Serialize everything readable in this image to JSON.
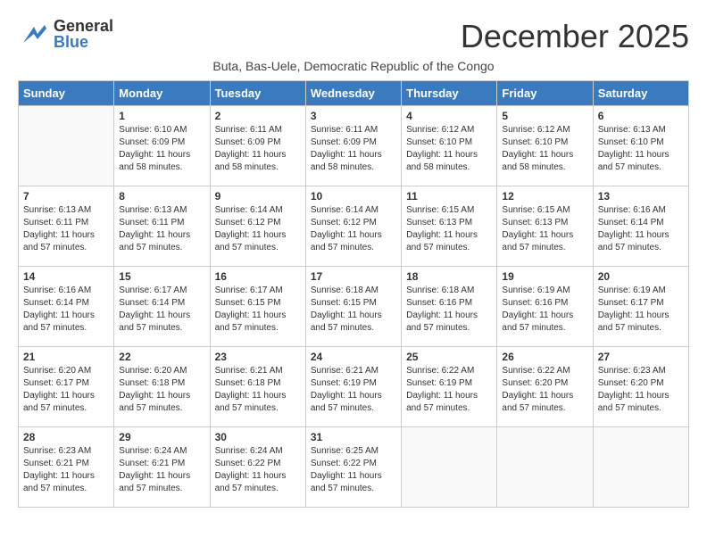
{
  "header": {
    "logo_general": "General",
    "logo_blue": "Blue",
    "month_title": "December 2025",
    "subtitle": "Buta, Bas-Uele, Democratic Republic of the Congo"
  },
  "days_of_week": [
    "Sunday",
    "Monday",
    "Tuesday",
    "Wednesday",
    "Thursday",
    "Friday",
    "Saturday"
  ],
  "weeks": [
    [
      {
        "day": "",
        "info": ""
      },
      {
        "day": "1",
        "info": "Sunrise: 6:10 AM\nSunset: 6:09 PM\nDaylight: 11 hours\nand 58 minutes."
      },
      {
        "day": "2",
        "info": "Sunrise: 6:11 AM\nSunset: 6:09 PM\nDaylight: 11 hours\nand 58 minutes."
      },
      {
        "day": "3",
        "info": "Sunrise: 6:11 AM\nSunset: 6:09 PM\nDaylight: 11 hours\nand 58 minutes."
      },
      {
        "day": "4",
        "info": "Sunrise: 6:12 AM\nSunset: 6:10 PM\nDaylight: 11 hours\nand 58 minutes."
      },
      {
        "day": "5",
        "info": "Sunrise: 6:12 AM\nSunset: 6:10 PM\nDaylight: 11 hours\nand 58 minutes."
      },
      {
        "day": "6",
        "info": "Sunrise: 6:13 AM\nSunset: 6:10 PM\nDaylight: 11 hours\nand 57 minutes."
      }
    ],
    [
      {
        "day": "7",
        "info": "Sunrise: 6:13 AM\nSunset: 6:11 PM\nDaylight: 11 hours\nand 57 minutes."
      },
      {
        "day": "8",
        "info": "Sunrise: 6:13 AM\nSunset: 6:11 PM\nDaylight: 11 hours\nand 57 minutes."
      },
      {
        "day": "9",
        "info": "Sunrise: 6:14 AM\nSunset: 6:12 PM\nDaylight: 11 hours\nand 57 minutes."
      },
      {
        "day": "10",
        "info": "Sunrise: 6:14 AM\nSunset: 6:12 PM\nDaylight: 11 hours\nand 57 minutes."
      },
      {
        "day": "11",
        "info": "Sunrise: 6:15 AM\nSunset: 6:13 PM\nDaylight: 11 hours\nand 57 minutes."
      },
      {
        "day": "12",
        "info": "Sunrise: 6:15 AM\nSunset: 6:13 PM\nDaylight: 11 hours\nand 57 minutes."
      },
      {
        "day": "13",
        "info": "Sunrise: 6:16 AM\nSunset: 6:14 PM\nDaylight: 11 hours\nand 57 minutes."
      }
    ],
    [
      {
        "day": "14",
        "info": "Sunrise: 6:16 AM\nSunset: 6:14 PM\nDaylight: 11 hours\nand 57 minutes."
      },
      {
        "day": "15",
        "info": "Sunrise: 6:17 AM\nSunset: 6:14 PM\nDaylight: 11 hours\nand 57 minutes."
      },
      {
        "day": "16",
        "info": "Sunrise: 6:17 AM\nSunset: 6:15 PM\nDaylight: 11 hours\nand 57 minutes."
      },
      {
        "day": "17",
        "info": "Sunrise: 6:18 AM\nSunset: 6:15 PM\nDaylight: 11 hours\nand 57 minutes."
      },
      {
        "day": "18",
        "info": "Sunrise: 6:18 AM\nSunset: 6:16 PM\nDaylight: 11 hours\nand 57 minutes."
      },
      {
        "day": "19",
        "info": "Sunrise: 6:19 AM\nSunset: 6:16 PM\nDaylight: 11 hours\nand 57 minutes."
      },
      {
        "day": "20",
        "info": "Sunrise: 6:19 AM\nSunset: 6:17 PM\nDaylight: 11 hours\nand 57 minutes."
      }
    ],
    [
      {
        "day": "21",
        "info": "Sunrise: 6:20 AM\nSunset: 6:17 PM\nDaylight: 11 hours\nand 57 minutes."
      },
      {
        "day": "22",
        "info": "Sunrise: 6:20 AM\nSunset: 6:18 PM\nDaylight: 11 hours\nand 57 minutes."
      },
      {
        "day": "23",
        "info": "Sunrise: 6:21 AM\nSunset: 6:18 PM\nDaylight: 11 hours\nand 57 minutes."
      },
      {
        "day": "24",
        "info": "Sunrise: 6:21 AM\nSunset: 6:19 PM\nDaylight: 11 hours\nand 57 minutes."
      },
      {
        "day": "25",
        "info": "Sunrise: 6:22 AM\nSunset: 6:19 PM\nDaylight: 11 hours\nand 57 minutes."
      },
      {
        "day": "26",
        "info": "Sunrise: 6:22 AM\nSunset: 6:20 PM\nDaylight: 11 hours\nand 57 minutes."
      },
      {
        "day": "27",
        "info": "Sunrise: 6:23 AM\nSunset: 6:20 PM\nDaylight: 11 hours\nand 57 minutes."
      }
    ],
    [
      {
        "day": "28",
        "info": "Sunrise: 6:23 AM\nSunset: 6:21 PM\nDaylight: 11 hours\nand 57 minutes."
      },
      {
        "day": "29",
        "info": "Sunrise: 6:24 AM\nSunset: 6:21 PM\nDaylight: 11 hours\nand 57 minutes."
      },
      {
        "day": "30",
        "info": "Sunrise: 6:24 AM\nSunset: 6:22 PM\nDaylight: 11 hours\nand 57 minutes."
      },
      {
        "day": "31",
        "info": "Sunrise: 6:25 AM\nSunset: 6:22 PM\nDaylight: 11 hours\nand 57 minutes."
      },
      {
        "day": "",
        "info": ""
      },
      {
        "day": "",
        "info": ""
      },
      {
        "day": "",
        "info": ""
      }
    ]
  ]
}
